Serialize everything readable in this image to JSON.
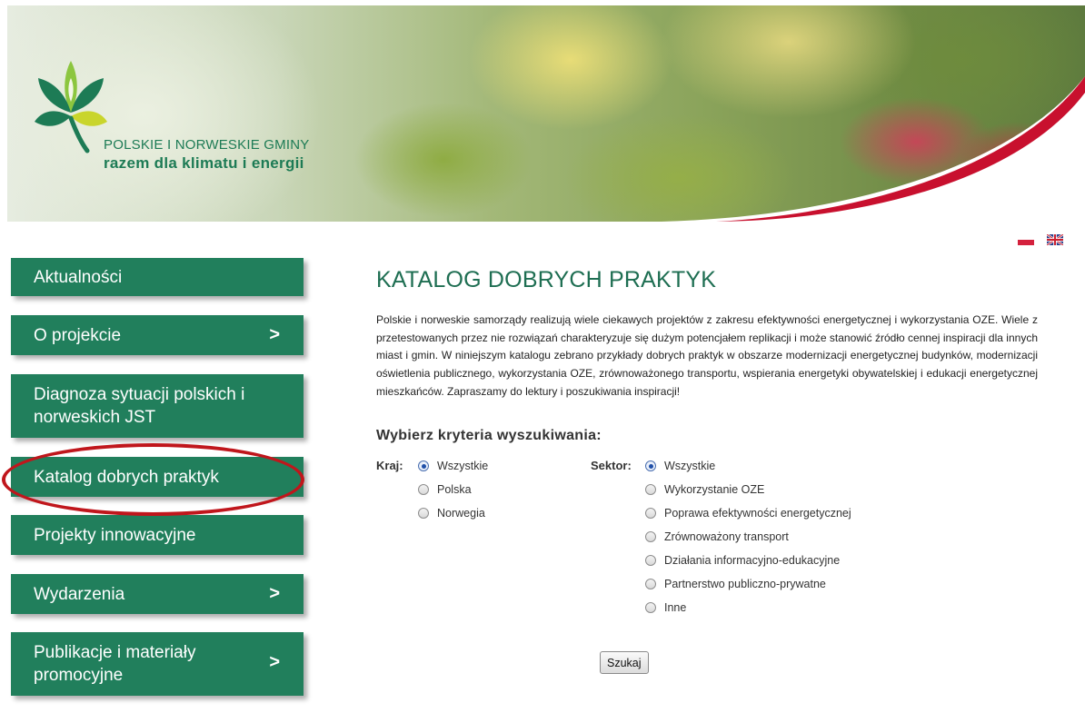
{
  "brand": {
    "line1": "POLSKIE I NORWESKIE GMINY",
    "line2": "razem dla klimatu i energii"
  },
  "languages": [
    {
      "code": "pl",
      "icon": "poland-flag-icon"
    },
    {
      "code": "en",
      "icon": "uk-flag-icon"
    }
  ],
  "nav": {
    "items": [
      {
        "label": "Aktualności",
        "has_arrow": false
      },
      {
        "label": "O projekcie",
        "has_arrow": true
      },
      {
        "label": "Diagnoza sytuacji polskich i norweskich JST",
        "has_arrow": false
      },
      {
        "label": "Katalog dobrych praktyk",
        "has_arrow": false,
        "highlighted": true
      },
      {
        "label": "Projekty innowacyjne",
        "has_arrow": false
      },
      {
        "label": "Wydarzenia",
        "has_arrow": true
      },
      {
        "label": "Publikacje i materiały promocyjne",
        "has_arrow": true
      }
    ],
    "arrow_glyph": ">"
  },
  "main": {
    "title": "KATALOG DOBRYCH PRAKTYK",
    "intro": "Polskie i norweskie samorządy realizują wiele ciekawych projektów z zakresu efektywności energetycznej i wykorzystania OZE. Wiele z przetestowanych przez nie rozwiązań charakteryzuje się dużym potencjałem replikacji i może stanowić źródło cennej inspiracji dla innych miast i gmin. W niniejszym katalogu zebrano przykłady dobrych praktyk w obszarze modernizacji energetycznej budynków, modernizacji oświetlenia publicznego, wykorzystania OZE, zrównoważonego transportu, wspierania energetyki obywatelskiej i edukacji energetycznej mieszkańców. Zapraszamy do lektury i poszukiwania inspiracji!",
    "criteria_heading": "Wybierz kryteria wyszukiwania:",
    "kraj": {
      "label": "Kraj:",
      "selected": 0,
      "options": [
        "Wszystkie",
        "Polska",
        "Norwegia"
      ]
    },
    "sektor": {
      "label": "Sektor:",
      "selected": 0,
      "options": [
        "Wszystkie",
        "Wykorzystanie OZE",
        "Poprawa efektywności energetycznej",
        "Zrównoważony transport",
        "Działania informacyjno-edukacyjne",
        "Partnerstwo publiczno-prywatne",
        "Inne"
      ]
    },
    "search_button": "Szukaj"
  },
  "colors": {
    "nav_bg": "#217f5c",
    "title": "#1e6e52",
    "highlight": "#c0161c",
    "brand_curve": "#c8102e"
  }
}
